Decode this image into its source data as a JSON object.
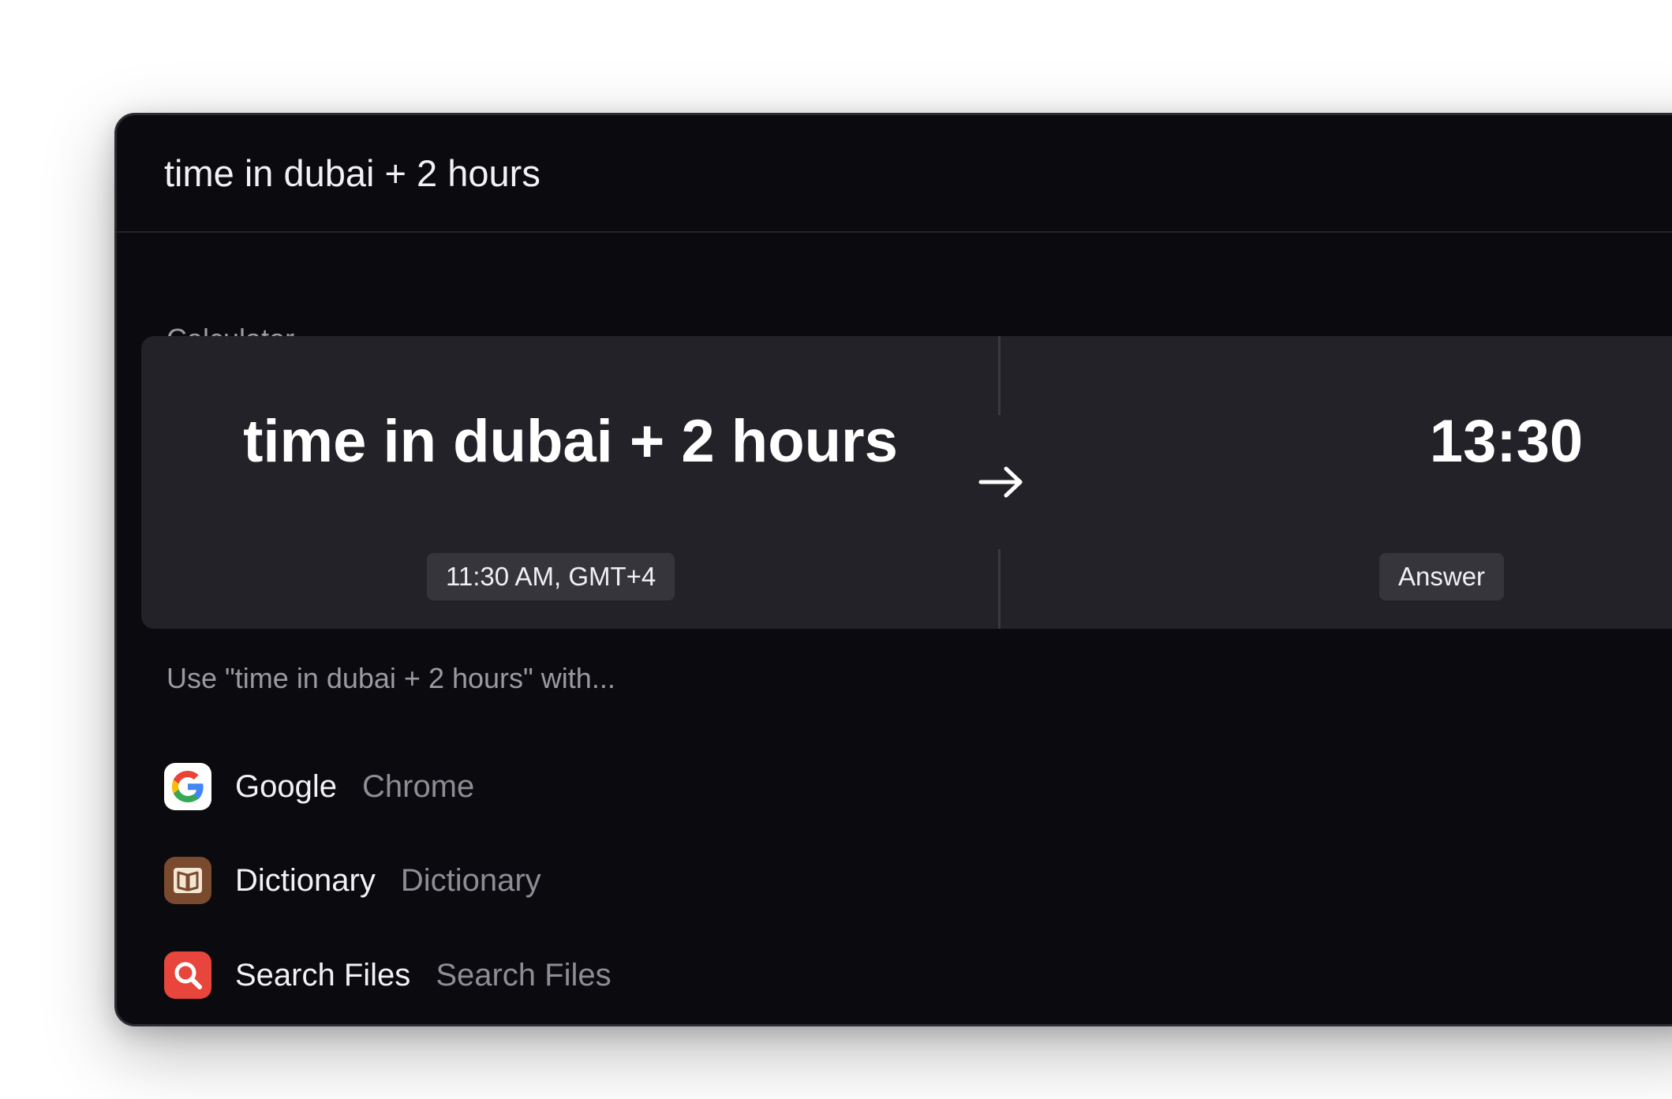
{
  "search": {
    "query": "time in dubai + 2 hours"
  },
  "calculator": {
    "section_title": "Calculator",
    "expression": "time in dubai + 2 hours",
    "expression_badge": "11:30 AM, GMT+4",
    "result": "13:30",
    "result_badge": "Answer"
  },
  "fallback": {
    "section_title": "Use \"time in dubai + 2 hours\" with...",
    "items": [
      {
        "title": "Google",
        "subtitle": "Chrome",
        "icon": "google-icon"
      },
      {
        "title": "Dictionary",
        "subtitle": "Dictionary",
        "icon": "book-icon"
      },
      {
        "title": "Search Files",
        "subtitle": "Search Files",
        "icon": "magnifier-icon"
      }
    ]
  },
  "colors": {
    "window_bg": "#0b0a0e",
    "card_bg": "#232228",
    "dictionary_icon_bg": "#7a4a2e",
    "search_files_icon_bg": "#e8453c"
  }
}
